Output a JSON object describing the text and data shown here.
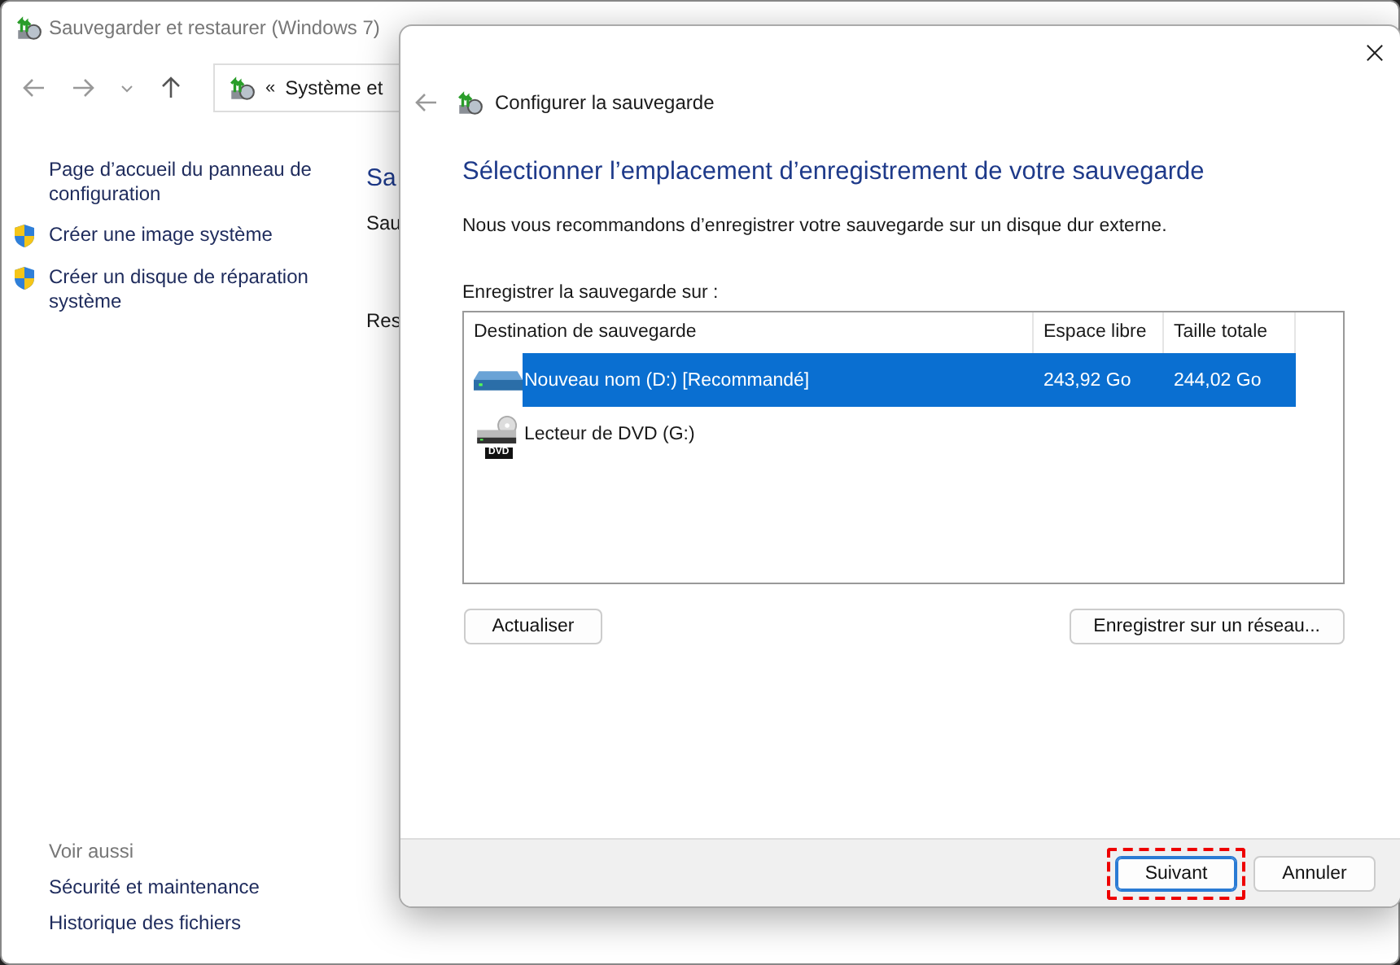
{
  "window": {
    "title": "Sauvegarder et restaurer (Windows 7)",
    "address": {
      "prefix": "«",
      "path": "Système et"
    }
  },
  "sidebar": {
    "items": [
      {
        "label": "Page d’accueil du panneau de configuration",
        "shield": false
      },
      {
        "label": "Créer une image système",
        "shield": true
      },
      {
        "label": "Créer un disque de réparation système",
        "shield": true
      }
    ],
    "see_also": {
      "heading": "Voir aussi",
      "links": [
        "Sécurité et maintenance",
        "Historique des fichiers"
      ]
    }
  },
  "main": {
    "heading": "Sa",
    "texts": [
      "Sau",
      "Res"
    ]
  },
  "dialog": {
    "title": "Configurer la sauvegarde",
    "heading": "Sélectionner l’emplacement d’enregistrement de votre sauvegarde",
    "description": "Nous vous recommandons d’enregistrer votre sauvegarde sur un disque dur externe.",
    "list_label": "Enregistrer la sauvegarde sur :",
    "table": {
      "columns": [
        "Destination de sauvegarde",
        "Espace libre",
        "Taille totale"
      ],
      "rows": [
        {
          "kind": "hdd",
          "name": "Nouveau nom (D:) [Recommandé]",
          "free": "243,92 Go",
          "total": "244,02 Go",
          "selected": true
        },
        {
          "kind": "dvd",
          "name": "Lecteur de DVD (G:)",
          "badge": "DVD",
          "selected": false
        }
      ]
    },
    "buttons": [
      {
        "label": "Actualiser"
      },
      {
        "label": "Enregistrer sur un réseau..."
      }
    ],
    "footer_buttons": [
      {
        "label": "Suivant",
        "default": true,
        "highlighted": true
      },
      {
        "label": "Annuler",
        "default": false,
        "highlighted": false
      }
    ]
  }
}
